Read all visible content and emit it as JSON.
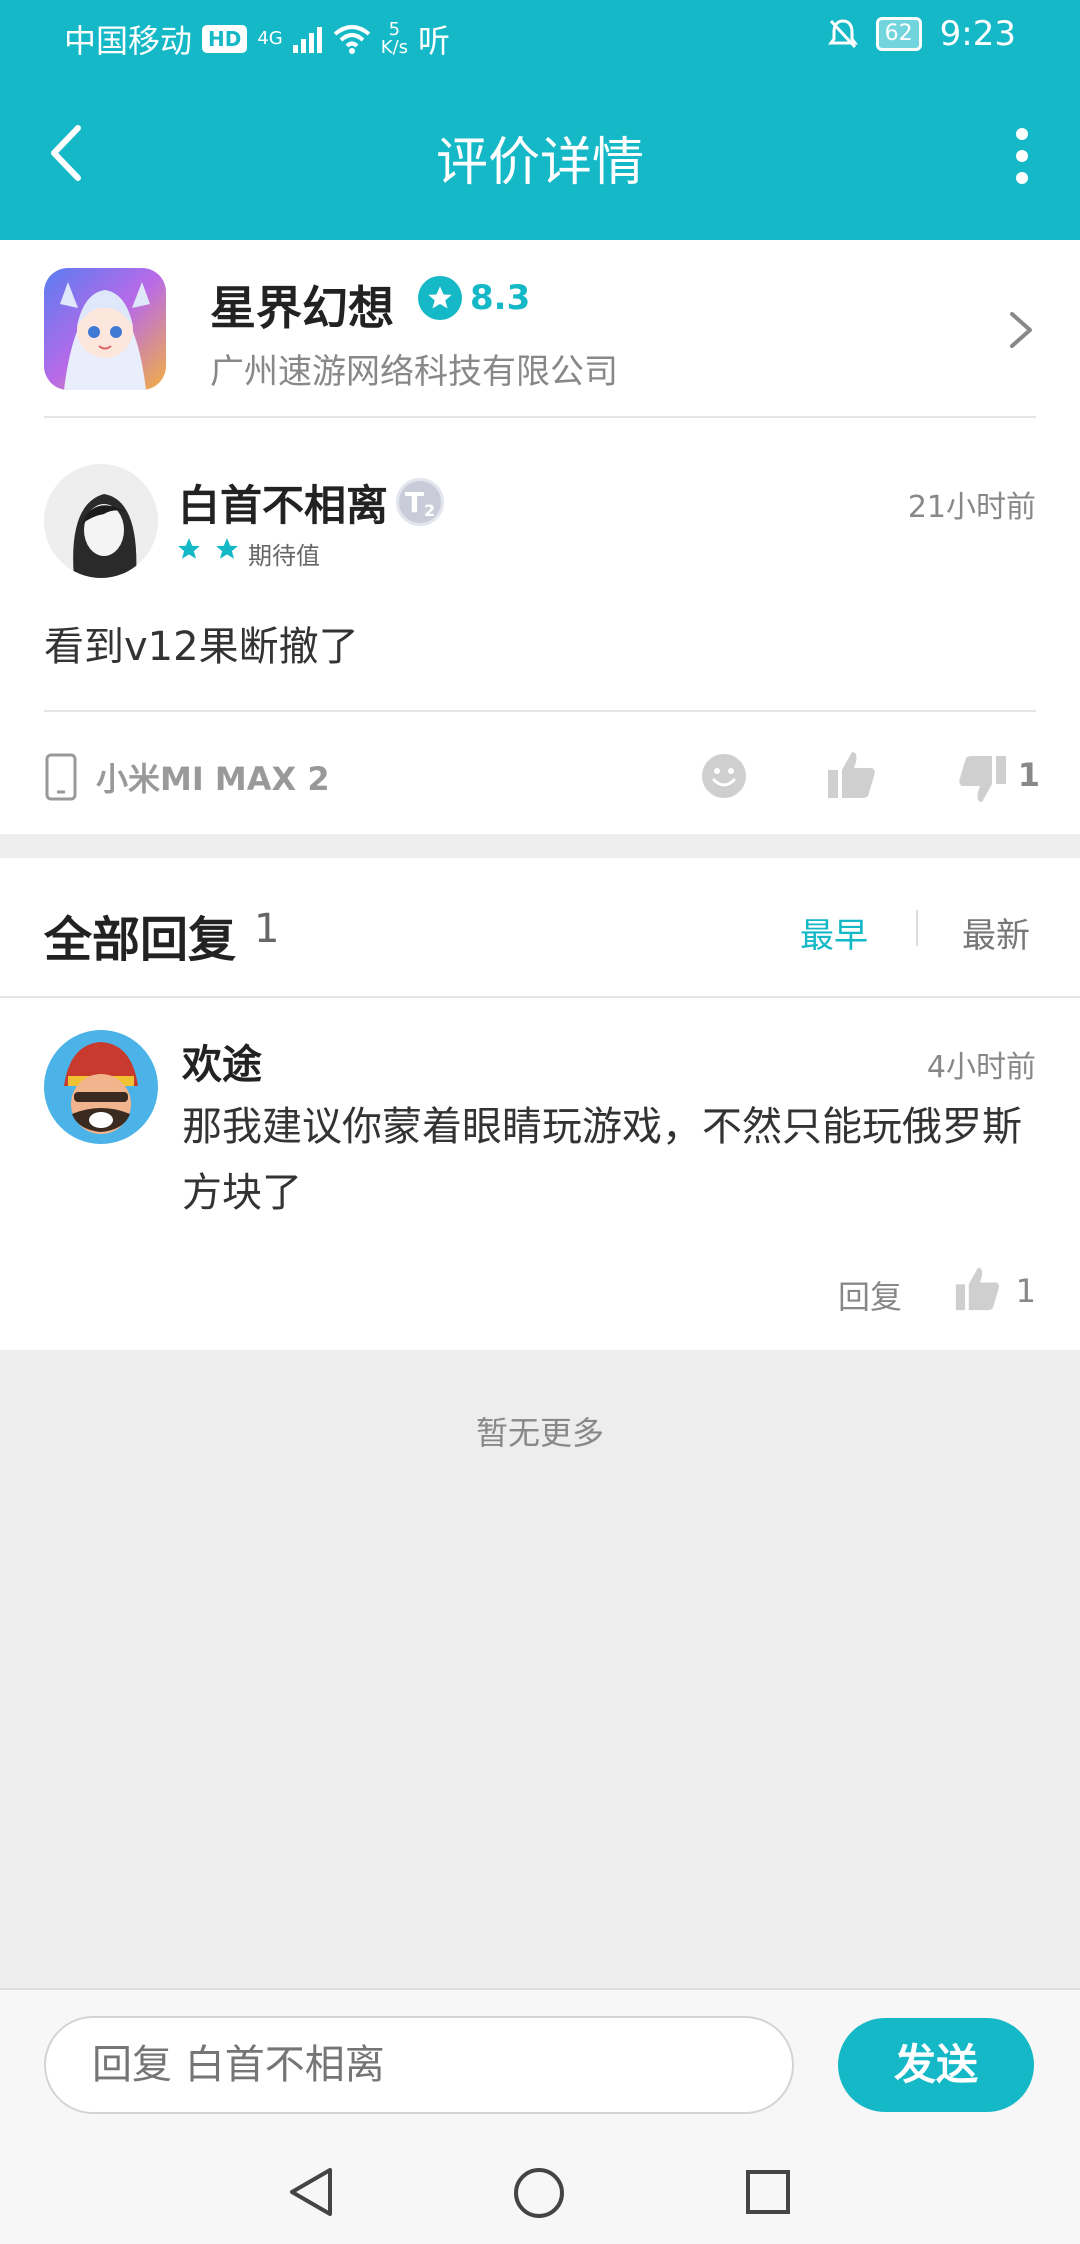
{
  "status_bar": {
    "carrier": "中国移动",
    "hd": "HD",
    "net_type": "4G",
    "speed_value": "5",
    "speed_unit": "K/s",
    "extra": "听",
    "battery": "62",
    "time": "9:23"
  },
  "nav": {
    "title": "评价详情"
  },
  "game": {
    "name": "星界幻想",
    "score": "8.3",
    "company": "广州速游网络科技有限公司"
  },
  "review": {
    "user": "白首不相离",
    "level": "T",
    "level_sub": "2",
    "time": "21小时前",
    "rating_label": "期待值",
    "rating_stars": 2,
    "text": "看到v12果断撤了",
    "device": "小米MI MAX 2",
    "dislike_count": "1"
  },
  "replies": {
    "title": "全部回复",
    "count": "1",
    "sort_earliest": "最早",
    "sort_latest": "最新",
    "items": [
      {
        "user": "欢途",
        "time": "4小时前",
        "text": "那我建议你蒙着眼睛玩游戏，不然只能玩俄罗斯方块了",
        "reply_label": "回复",
        "like_count": "1"
      }
    ],
    "no_more": "暂无更多"
  },
  "composer": {
    "placeholder": "回复 白首不相离",
    "send_label": "发送"
  },
  "colors": {
    "accent": "#14b8c6",
    "background": "#ededed"
  }
}
